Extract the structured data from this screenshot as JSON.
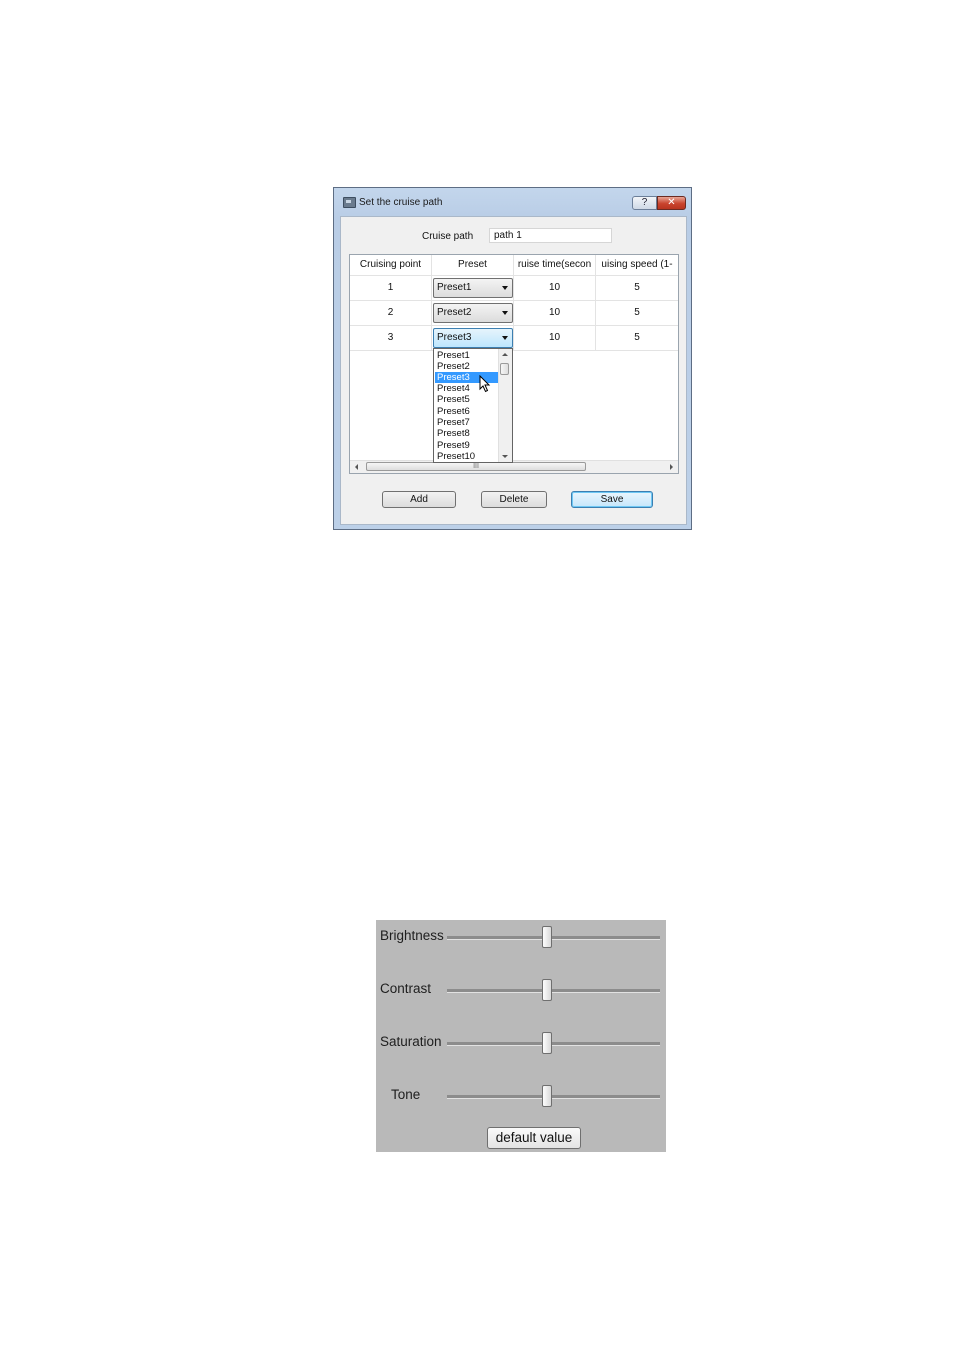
{
  "dialog": {
    "title": "Set the cruise path",
    "help_label": "?",
    "close_label": "✕",
    "cruise_path_label": "Cruise path",
    "cruise_path_value": "path 1",
    "columns": [
      "Cruising point",
      "Preset",
      "ruise time(secon",
      "uising speed (1-"
    ],
    "rows": [
      {
        "point": "1",
        "preset": "Preset1",
        "time": "10",
        "speed": "5"
      },
      {
        "point": "2",
        "preset": "Preset2",
        "time": "10",
        "speed": "5"
      },
      {
        "point": "3",
        "preset": "Preset3",
        "time": "10",
        "speed": "5"
      }
    ],
    "dropdown_options": [
      "Preset1",
      "Preset2",
      "Preset3",
      "Preset4",
      "Preset5",
      "Preset6",
      "Preset7",
      "Preset8",
      "Preset9",
      "Preset10"
    ],
    "dropdown_selected": "Preset3",
    "scroll_thumb_label": "III",
    "buttons": {
      "add": "Add",
      "delete": "Delete",
      "save": "Save"
    }
  },
  "image_settings": {
    "sliders": [
      {
        "label": "Brightness",
        "value": 0.47
      },
      {
        "label": "Contrast",
        "value": 0.47
      },
      {
        "label": "Saturation",
        "value": 0.47
      },
      {
        "label": "Tone",
        "value": 0.47
      }
    ],
    "default_button": "default value"
  },
  "colors": {
    "selection": "#3399ff",
    "panel_background": "#b9b9b9",
    "close_button": "#c9432d"
  }
}
